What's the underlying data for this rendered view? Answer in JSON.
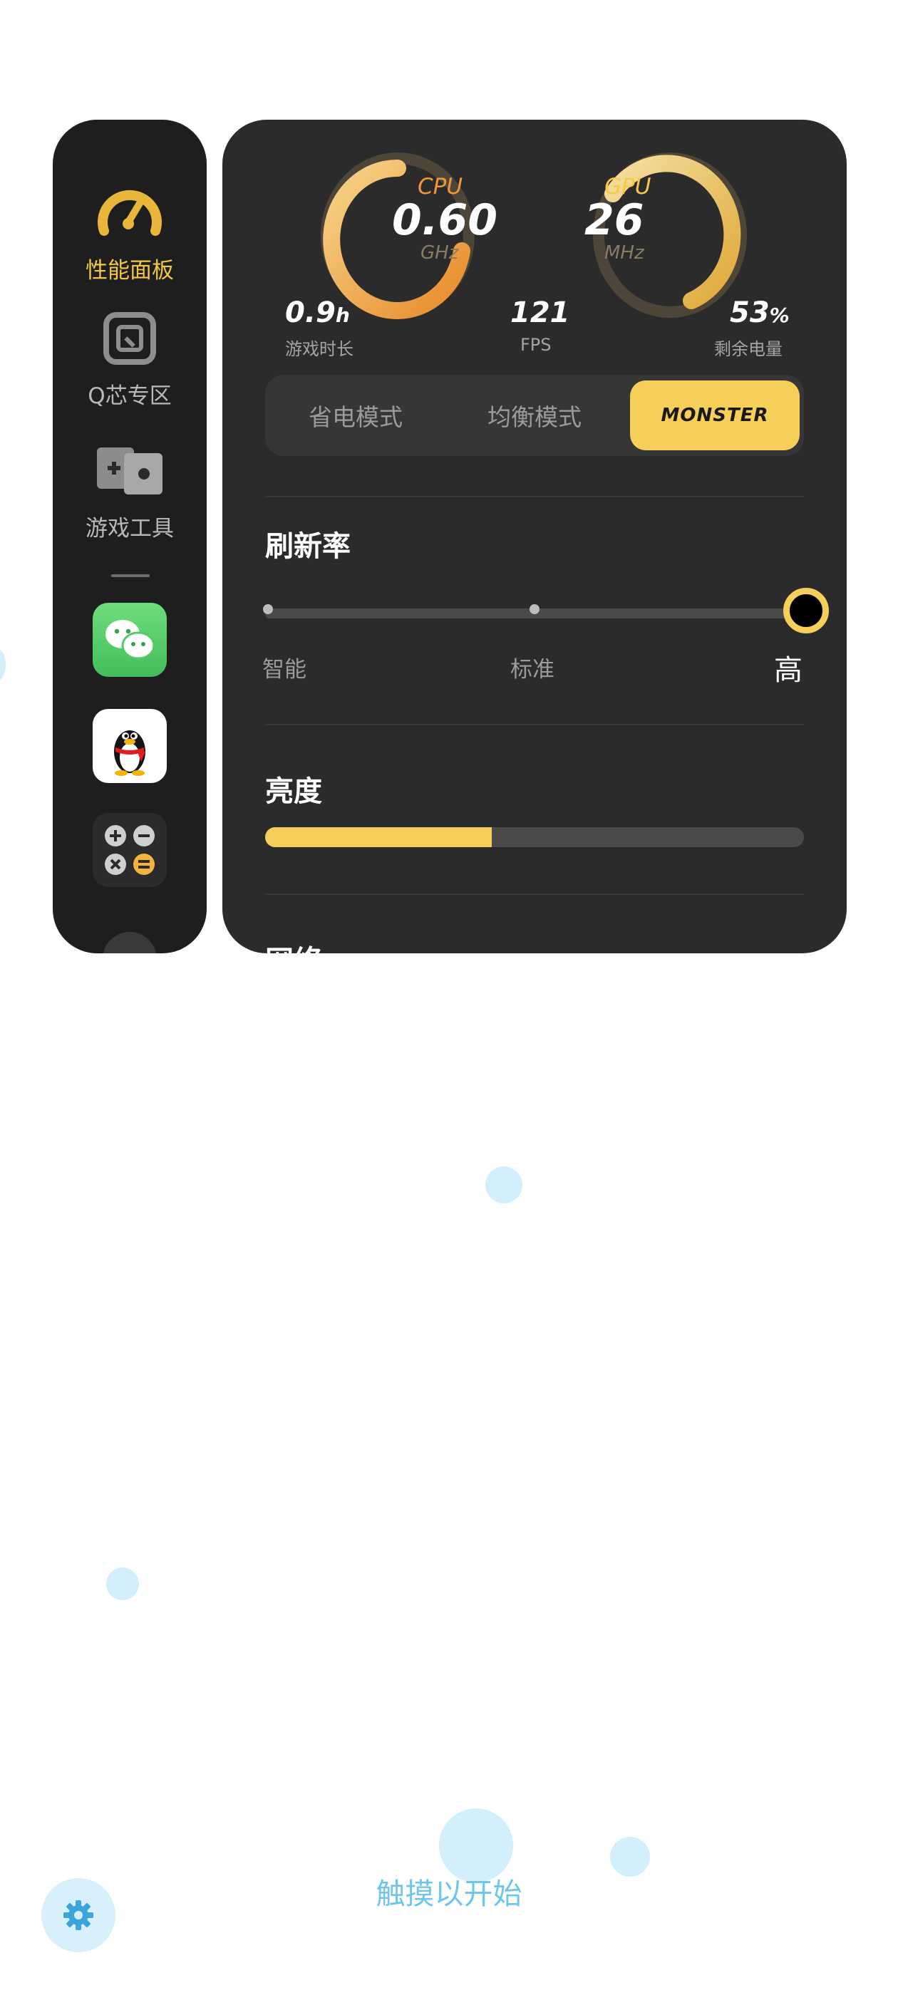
{
  "sidebar": {
    "items": [
      {
        "label": "性能面板",
        "icon": "speedometer-icon",
        "active": true
      },
      {
        "label": "Q芯专区",
        "icon": "q-chip-icon",
        "active": false
      },
      {
        "label": "游戏工具",
        "icon": "gamepad-icon",
        "active": false
      }
    ],
    "apps": [
      {
        "name": "wechat-icon"
      },
      {
        "name": "qq-icon"
      },
      {
        "name": "calculator-icon"
      }
    ]
  },
  "performance": {
    "cpu": {
      "label": "CPU",
      "value": "0.60",
      "unit": "GHz"
    },
    "gpu": {
      "label": "GPU",
      "value": "26",
      "unit": "MHz"
    },
    "stats": [
      {
        "value": "0.9",
        "suffix": "h",
        "label": "游戏时长"
      },
      {
        "value": "121",
        "suffix": "",
        "label": "FPS"
      },
      {
        "value": "53",
        "suffix": "%",
        "label": "剩余电量"
      }
    ],
    "modes": [
      "省电模式",
      "均衡模式",
      "MONSTER"
    ],
    "active_mode": "MONSTER"
  },
  "refresh_rate": {
    "title": "刷新率",
    "options": [
      "智能",
      "标准",
      "高"
    ],
    "selected": "高"
  },
  "brightness": {
    "title": "亮度",
    "level": 0.42
  },
  "network": {
    "title": "网络"
  },
  "footer": {
    "hint": "触摸以开始"
  },
  "colors": {
    "accent": "#f6cf5a",
    "cpu_label": "#f0973a",
    "gpu_label": "#f6c84a",
    "hint": "#6fc6ea"
  }
}
